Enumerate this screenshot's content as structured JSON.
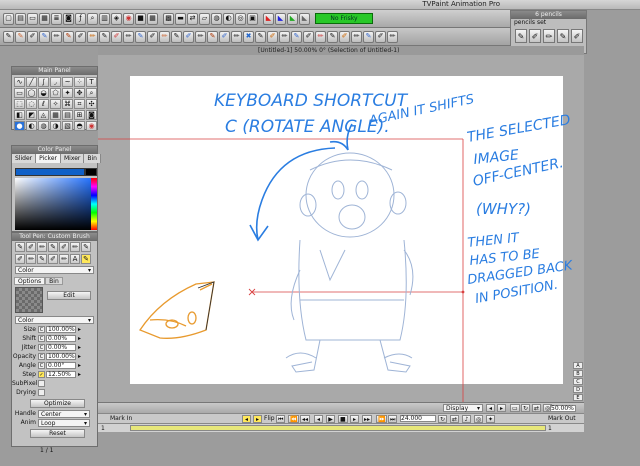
{
  "app": {
    "title": "TVPaint Animation Pro"
  },
  "toolbar": {
    "frisky_label": "No Frisky",
    "icons": [
      "open-icon",
      "save-icon",
      "folder-icon",
      "new-icon",
      "layers-icon",
      "camera-icon",
      "fx-icon",
      "zoom-icon",
      "print-icon",
      "cube-icon",
      "color-wheel-icon",
      "square-icon",
      "grid-icon",
      "grid2-icon",
      "timeline-icon",
      "flip-icon",
      "ruler-icon",
      "globe-icon",
      "palette-icon",
      "eye-icon",
      "film-icon",
      "tri-red-icon",
      "tri-blue-icon",
      "tri-green-icon",
      "tri-gray-icon"
    ]
  },
  "pencil_panel": {
    "header": "6 pencils",
    "label": "pencils set"
  },
  "tool_panel": {
    "header": "Main Panel"
  },
  "color_panel": {
    "header": "Color Panel",
    "tabs": [
      "Slider",
      "Picker",
      "Mixer",
      "Bin"
    ],
    "active_tab": "Picker",
    "primary_color": "#0f60c8"
  },
  "pen_panel": {
    "header": "Tool Pen: Custom Brush",
    "color_mode": "Color",
    "tabs": [
      "Options",
      "Bin"
    ],
    "edit_label": "Edit",
    "color2": "Color",
    "params": [
      {
        "label": "Size",
        "mode": "C",
        "value": "100.00%"
      },
      {
        "label": "Shift",
        "mode": "C",
        "value": "0.00%"
      },
      {
        "label": "Jitter",
        "mode": "C",
        "value": "0.00%"
      },
      {
        "label": "Opacity",
        "mode": "C",
        "value": "100.00%"
      },
      {
        "label": "Angle",
        "mode": "C",
        "value": "0.00°"
      },
      {
        "label": "Step",
        "mode": "✓",
        "value": "12.50%"
      }
    ],
    "subpixel_label": "SubPixel",
    "drying_label": "Drying",
    "optimize_label": "Optimize",
    "handle_label": "Handle",
    "handle_value": "Center",
    "anim_label": "Anim",
    "anim_value": "Loop",
    "reset_label": "Reset",
    "page_label": "1 / 1"
  },
  "canvas": {
    "doc_title": "[Untitled-1]  50.00%  0°  (Selection of Untitled-1)",
    "annotation_lines": [
      "KEYBOARD SHORTCUT",
      "C (ROTATE ANGLE).",
      "AGAIN IT SHIFTS",
      "THE SELECTED",
      "IMAGE",
      "OFF-CENTER.",
      "(WHY?)",
      "THEN IT",
      "HAS TO BE",
      "DRAGGED BACK",
      "IN POSITION."
    ]
  },
  "viewbar": {
    "display_label": "Display",
    "zoom_value": "50.00%"
  },
  "timeline": {
    "mark_in": "Mark In",
    "mark_out": "Mark Out",
    "start_frame": "1",
    "end_frame": "1",
    "flip_label": "Flip",
    "fps_value": "24.000"
  }
}
